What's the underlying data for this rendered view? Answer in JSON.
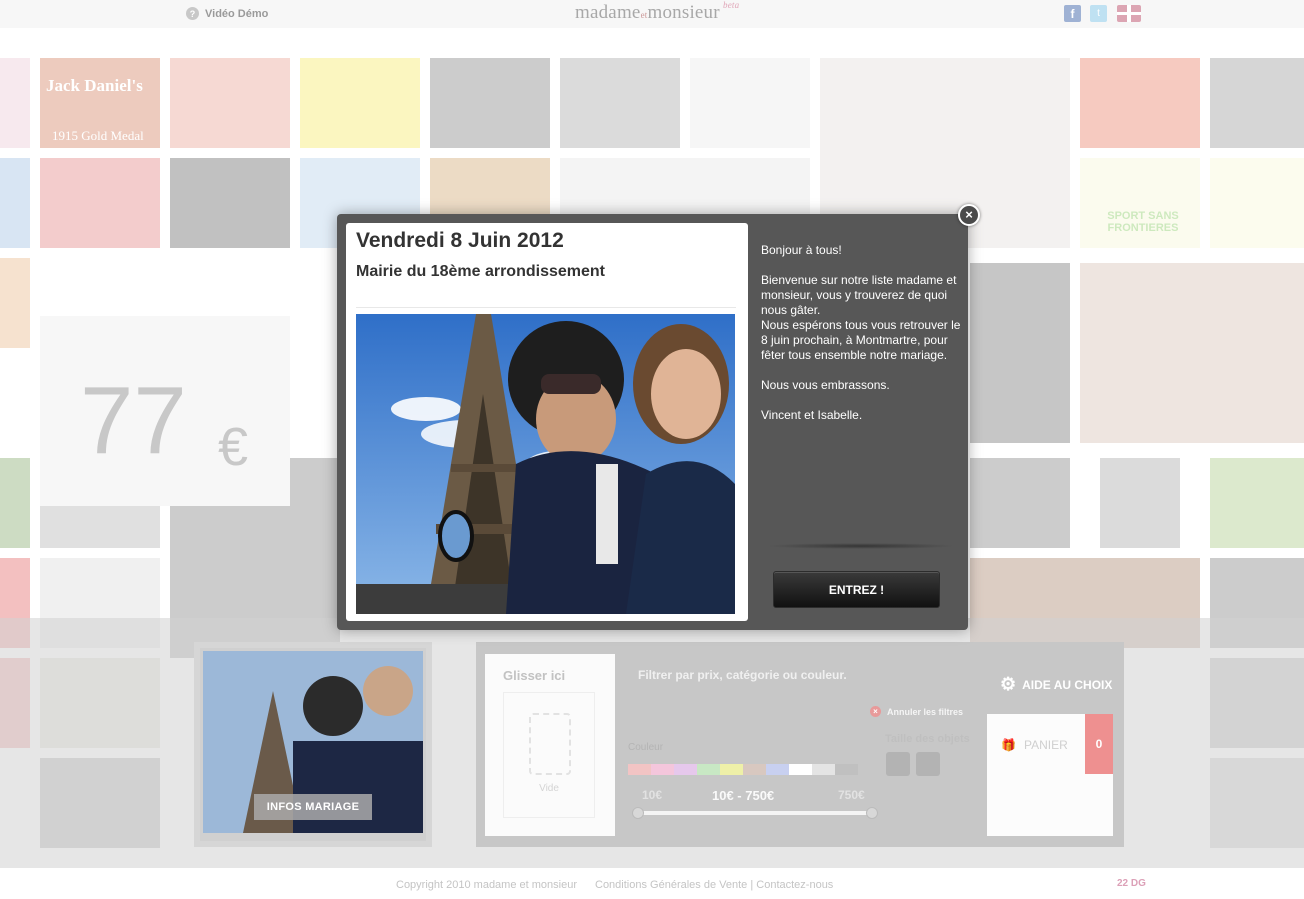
{
  "header": {
    "demo_label": "Vidéo Démo",
    "logo_text_1": "madame",
    "logo_text_et": "et",
    "logo_text_2": "monsieur",
    "logo_beta": "beta"
  },
  "background": {
    "price_value": "77",
    "price_currency": "€",
    "jack_daniels_text": "Jack Daniel's",
    "gold_medal_text": "1915 Gold Medal",
    "sport_text": "SPORT SANS FRONTIERES"
  },
  "modal": {
    "date": "Vendredi 8 Juin 2012",
    "venue": "Mairie du 18ème arrondissement",
    "greeting": "Bonjour à tous!",
    "message": "Bienvenue sur notre liste madame et monsieur, vous y trouverez de quoi nous gâter.",
    "message_2": "Nous espérons tous vous retrouver le 8 juin prochain, à Montmartre, pour fêter tous ensemble notre mariage.",
    "closing": "Nous vous embrassons.",
    "signature": "Vincent et Isabelle.",
    "enter_button": "ENTREZ !",
    "close_symbol": "×"
  },
  "bottom_panel": {
    "infos_button": "INFOS MARIAGE",
    "drop_title": "Glisser ici",
    "drop_empty": "Vide",
    "filter_title": "Filtrer par prix, catégorie ou couleur.",
    "reset_filters": "Annuler les filtres",
    "color_label": "Couleur",
    "size_label": "Taille des objets",
    "price_min": "10€",
    "price_range": "10€ - 750€",
    "price_max": "750€",
    "help_button": "AIDE AU CHOIX",
    "cart_label": "PANIER",
    "cart_count": "0",
    "swatch_colors": [
      "#f2c4c4",
      "#f4c6dc",
      "#e6c8ec",
      "#c8e8c4",
      "#eef0a8",
      "#d8c8c0",
      "#c8d0f0",
      "#ffffff",
      "#e4e4e4",
      "#c0c0c0"
    ]
  },
  "footer": {
    "copyright": "Copyright 2010 madame et monsieur",
    "cgv_link": "Conditions Générales de Vente",
    "separator": "|",
    "contact_link": "Contactez-nous",
    "agency": "22 DG"
  },
  "colors": {
    "modal_bg": "#575757",
    "accent_pink": "#ee9090"
  }
}
